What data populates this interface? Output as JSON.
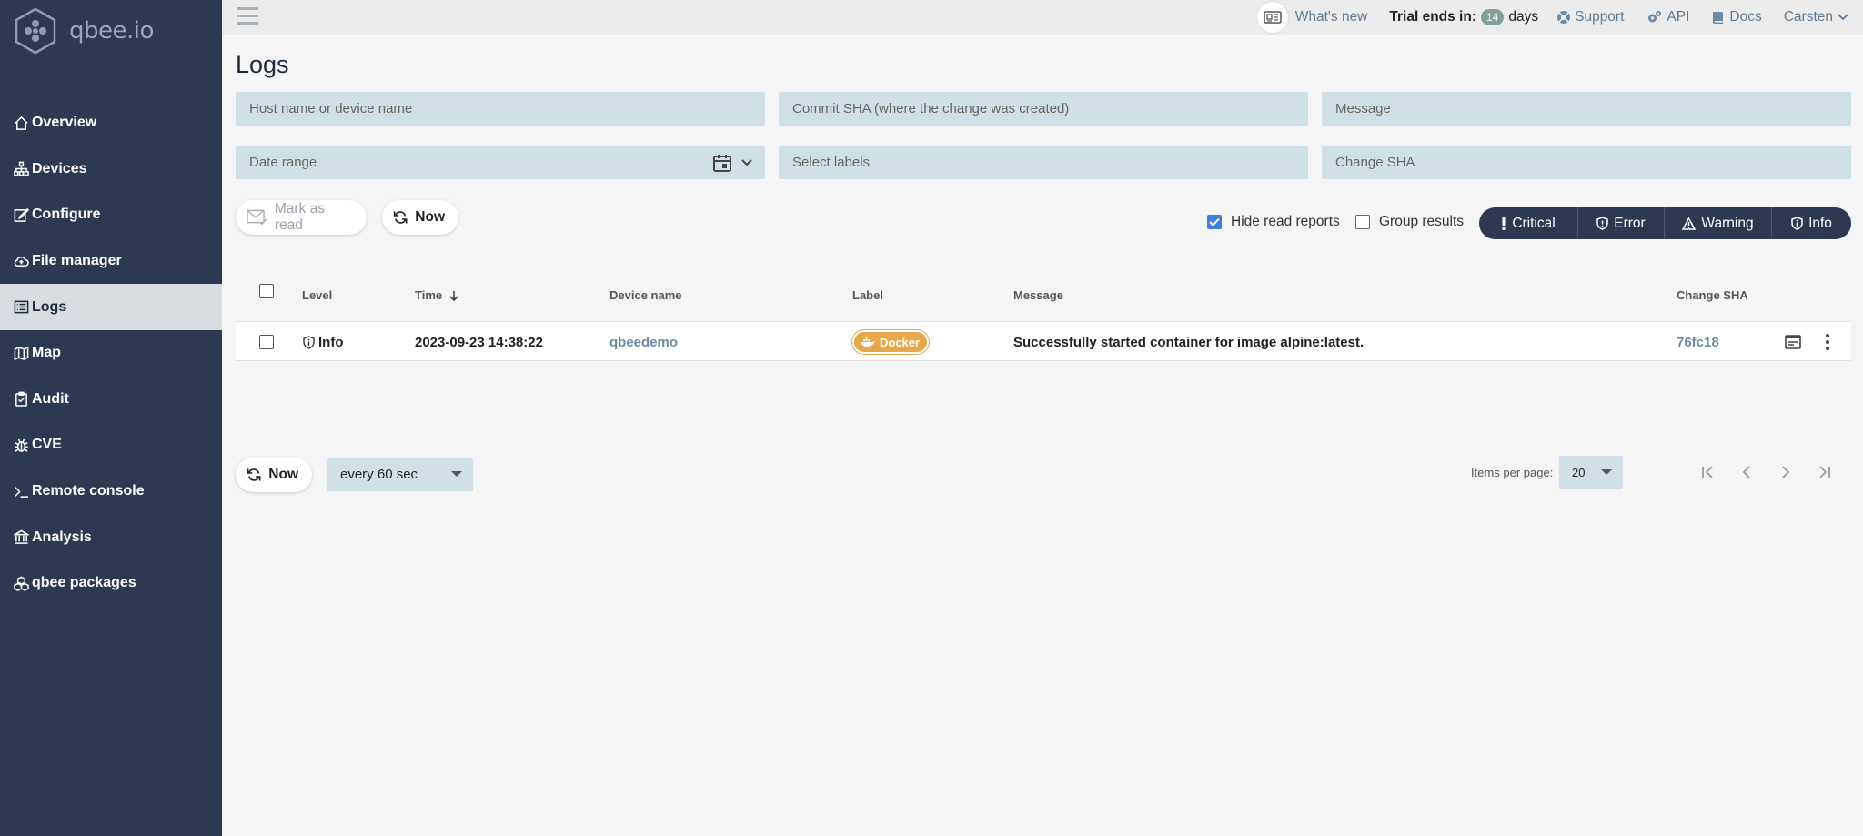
{
  "app": {
    "logo_text": "qbee.io"
  },
  "sidebar": {
    "items": [
      {
        "label": "Overview",
        "icon": "home-icon"
      },
      {
        "label": "Devices",
        "icon": "sitemap-icon"
      },
      {
        "label": "Configure",
        "icon": "edit-icon"
      },
      {
        "label": "File manager",
        "icon": "cloud-upload-icon"
      },
      {
        "label": "Logs",
        "icon": "list-icon",
        "active": true
      },
      {
        "label": "Map",
        "icon": "map-icon"
      },
      {
        "label": "Audit",
        "icon": "clipboard-icon"
      },
      {
        "label": "CVE",
        "icon": "bug-icon"
      },
      {
        "label": "Remote console",
        "icon": "terminal-icon"
      },
      {
        "label": "Analysis",
        "icon": "bank-icon"
      },
      {
        "label": "qbee packages",
        "icon": "cubes-icon"
      }
    ]
  },
  "topbar": {
    "whats_new": "What's new",
    "trial_prefix": "Trial ends in:",
    "trial_days": "14",
    "trial_suffix": "days",
    "support": "Support",
    "api": "API",
    "docs": "Docs",
    "user": "Carsten"
  },
  "page": {
    "title": "Logs"
  },
  "filters": {
    "host_placeholder": "Host name or device name",
    "commit_placeholder": "Commit SHA (where the change was created)",
    "message_placeholder": "Message",
    "date_placeholder": "Date range",
    "labels_placeholder": "Select labels",
    "change_placeholder": "Change SHA"
  },
  "actions": {
    "mark_read": "Mark as read",
    "now": "Now",
    "hide_read": "Hide read reports",
    "hide_read_checked": true,
    "group_results": "Group results",
    "group_results_checked": false
  },
  "levels": {
    "critical": "Critical",
    "error": "Error",
    "warning": "Warning",
    "info": "Info"
  },
  "table": {
    "headers": {
      "level": "Level",
      "time": "Time",
      "device": "Device name",
      "label": "Label",
      "message": "Message",
      "change_sha": "Change SHA"
    },
    "rows": [
      {
        "level": "Info",
        "time": "2023-09-23 14:38:22",
        "device": "qbeedemo",
        "label": "Docker",
        "message": "Successfully started container for image alpine:latest.",
        "change_sha": "76fc18"
      }
    ]
  },
  "footer": {
    "now": "Now",
    "refresh_interval": "every 60 sec",
    "items_per_page_label": "Items per page:",
    "items_per_page": "20"
  },
  "colors": {
    "sidebar_bg": "#2b3a52",
    "field_bg": "#cfe0e6",
    "docker_badge": "#e6a84a",
    "link": "#6d8aa5",
    "checkbox_on": "#3d7ee0"
  }
}
